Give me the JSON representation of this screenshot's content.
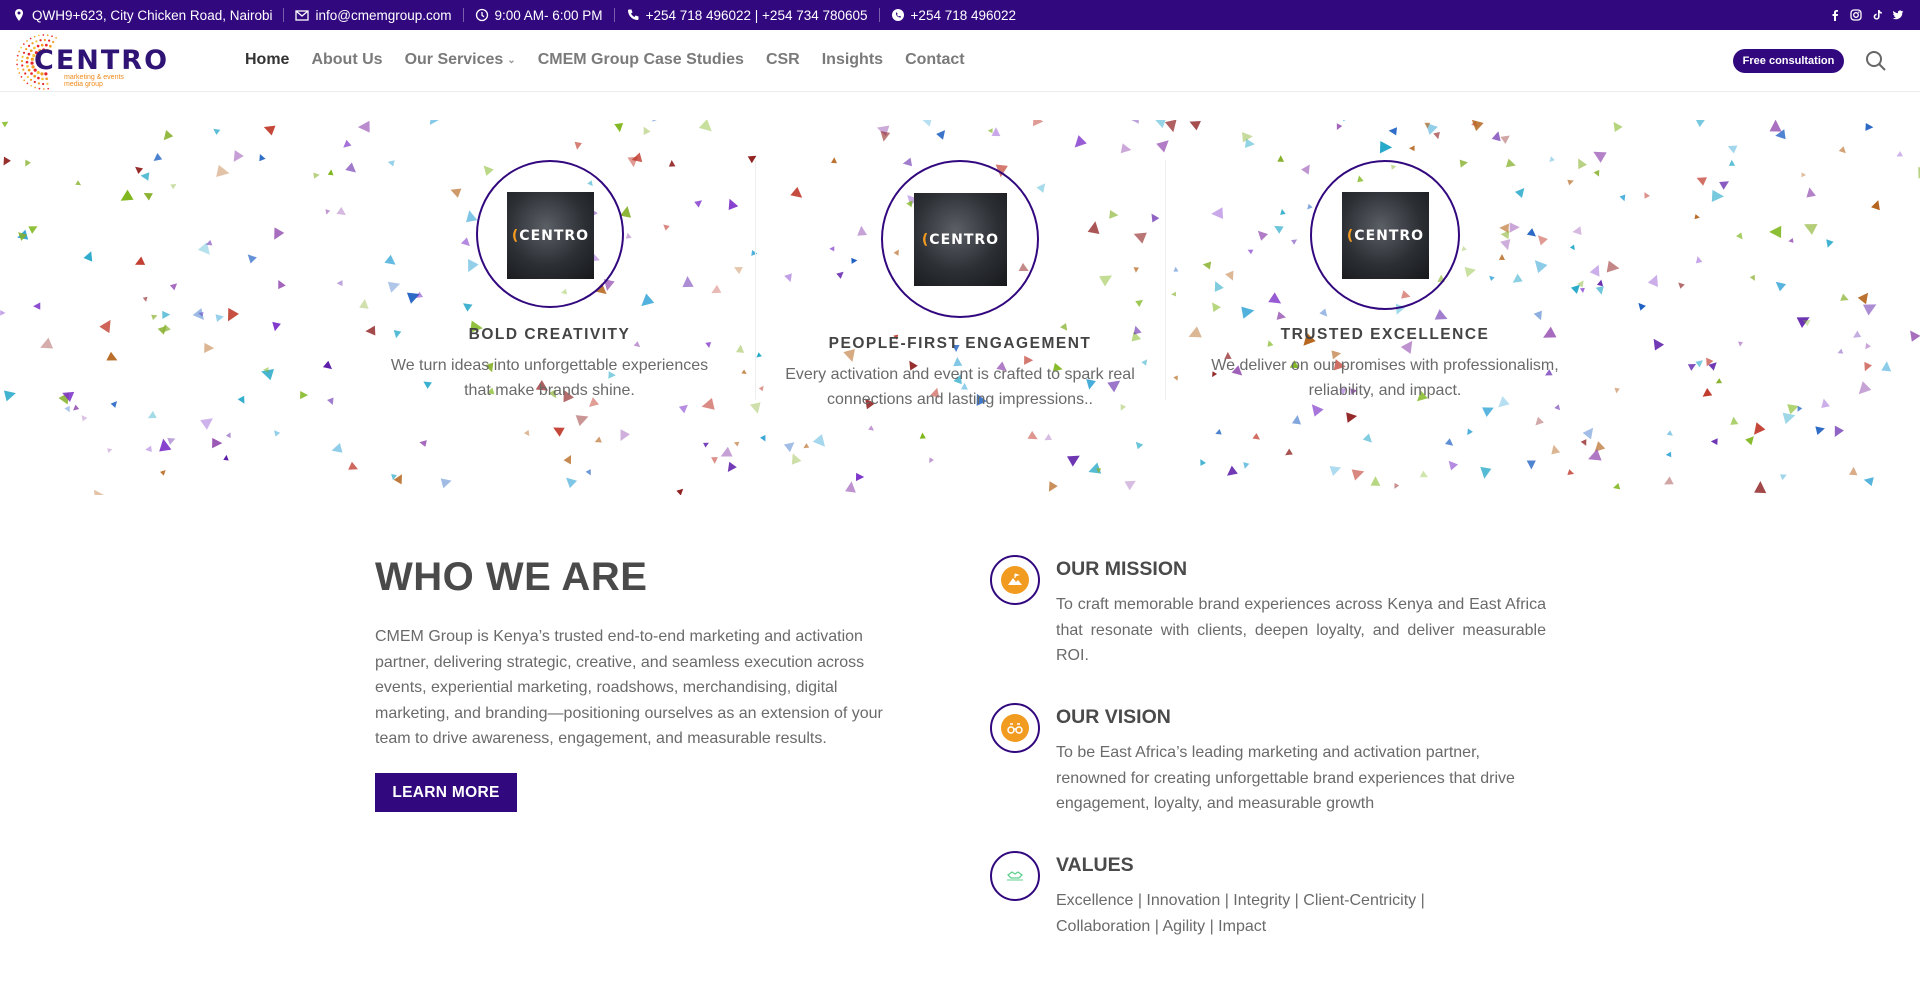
{
  "topbar": {
    "address": "QWH9+623, City Chicken Road, Nairobi",
    "email": "info@cmemgroup.com",
    "hours": "9:00 AM- 6:00 PM",
    "phones": "+254 718 496022 | +254 734 780605",
    "whatsapp": "+254 718 496022",
    "social_icons": [
      "facebook-icon",
      "instagram-icon",
      "tiktok-icon",
      "twitter-icon"
    ]
  },
  "header": {
    "logo_text": "CENTRO",
    "logo_tagline_1": "marketing & events",
    "logo_tagline_2": "media group",
    "nav": [
      {
        "label": "Home",
        "active": true
      },
      {
        "label": "About Us"
      },
      {
        "label": "Our Services",
        "dropdown": true
      },
      {
        "label": "CMEM Group Case Studies"
      },
      {
        "label": "CSR"
      },
      {
        "label": "Insights"
      },
      {
        "label": "Contact"
      }
    ],
    "cta": "Free consultation"
  },
  "hero": {
    "cards": [
      {
        "title": "BOLD CREATIVITY",
        "text": "We turn ideas into unforgettable experiences that make brands shine.",
        "image_text": "CENTRO"
      },
      {
        "title": "PEOPLE-FIRST ENGAGEMENT",
        "text": "Every activation and event is crafted to spark real connections and lasting impressions..",
        "image_text": "CENTRO"
      },
      {
        "title": "TRUSTED EXCELLENCE",
        "text": "We deliver on our promises with professionalism, reliability, and impact.",
        "image_text": "CENTRO"
      }
    ]
  },
  "who": {
    "title": "WHO WE ARE",
    "text": "CMEM Group is Kenya’s trusted end-to-end marketing and activation partner, delivering strategic, creative, and seamless execution across events, experiential marketing, roadshows, merchandising, digital marketing, and branding—positioning ourselves as an extension of your team to drive awareness, engagement, and measurable results.",
    "button": "LEARN MORE"
  },
  "mission": {
    "title": "OUR MISSION",
    "text": "To craft memorable brand experiences across Kenya and East Africa that resonate with clients, deepen loyalty, and deliver measurable ROI."
  },
  "vision": {
    "title": "OUR VISION",
    "text": "To be East Africa’s leading marketing and activation partner, renowned for creating unforgettable brand experiences that drive engagement, loyalty, and measurable growth"
  },
  "values": {
    "title": "VALUES",
    "line1": "Excellence | Innovation | Integrity | Client-Centricity |",
    "line2": "Collaboration | Agility | Impact"
  },
  "colors": {
    "brand_purple": "#32087f",
    "accent_orange": "#f29b21"
  }
}
